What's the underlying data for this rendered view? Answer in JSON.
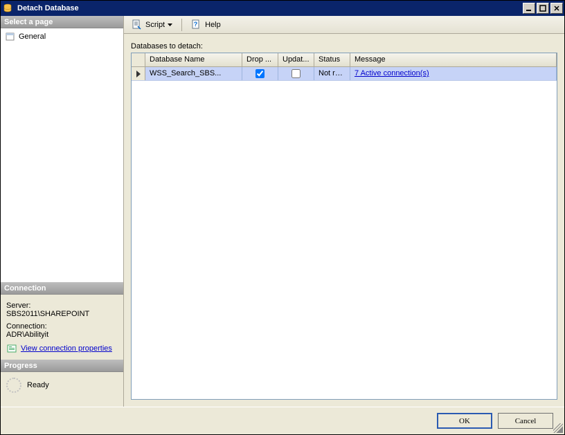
{
  "window": {
    "title": "Detach Database"
  },
  "left": {
    "select_page_header": "Select a page",
    "nav_general": "General",
    "connection_header": "Connection",
    "server_label": "Server:",
    "server_value": "SBS2011\\SHAREPOINT",
    "connection_label": "Connection:",
    "connection_value": "ADR\\Abilityit",
    "view_connection_link": "View connection properties",
    "progress_header": "Progress",
    "progress_status": "Ready"
  },
  "toolbar": {
    "script_label": "Script",
    "help_label": "Help"
  },
  "main": {
    "grid_label": "Databases to detach:",
    "columns": {
      "name": "Database Name",
      "drop": "Drop ...",
      "update": "Updat...",
      "status": "Status",
      "message": "Message"
    },
    "rows": [
      {
        "name": "WSS_Search_SBS...",
        "drop": true,
        "update": false,
        "status": "Not re...",
        "message": "7 Active connection(s)"
      }
    ]
  },
  "footer": {
    "ok": "OK",
    "cancel": "Cancel"
  }
}
